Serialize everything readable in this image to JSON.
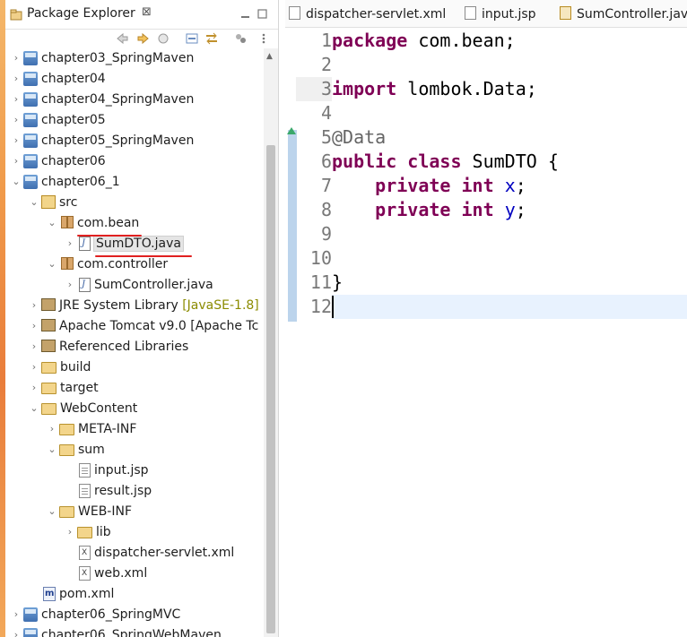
{
  "explorer": {
    "title": "Package Explorer",
    "close_glyph": "⊠",
    "tree": [
      {
        "label": "chapter03_SpringMaven",
        "chev": "›",
        "icon": "maven-project-icon",
        "depth": 0
      },
      {
        "label": "chapter04",
        "chev": "›",
        "icon": "spring-project-icon",
        "depth": 0
      },
      {
        "label": "chapter04_SpringMaven",
        "chev": "›",
        "icon": "maven-project-icon",
        "depth": 0
      },
      {
        "label": "chapter05",
        "chev": "›",
        "icon": "spring-project-icon",
        "depth": 0
      },
      {
        "label": "chapter05_SpringMaven",
        "chev": "›",
        "icon": "maven-project-icon",
        "depth": 0
      },
      {
        "label": "chapter06",
        "chev": "›",
        "icon": "spring-project-icon",
        "depth": 0
      },
      {
        "label": "chapter06_1",
        "chev": "⌄",
        "icon": "maven-project-icon",
        "depth": 0
      },
      {
        "label": "src",
        "chev": "⌄",
        "icon": "source-folder-icon",
        "depth": 1
      },
      {
        "label": "com.bean",
        "chev": "⌄",
        "icon": "package-icon",
        "depth": 2
      },
      {
        "label": "SumDTO.java",
        "chev": "›",
        "icon": "java-file-icon",
        "depth": 3,
        "selected": true
      },
      {
        "label": "com.controller",
        "chev": "⌄",
        "icon": "package-icon",
        "depth": 2
      },
      {
        "label": "SumController.java",
        "chev": "›",
        "icon": "java-file-icon",
        "depth": 3
      },
      {
        "label": "JRE System Library",
        "decoration": "[JavaSE-1.8]",
        "chev": "›",
        "icon": "library-icon",
        "depth": 1
      },
      {
        "label": "Apache Tomcat v9.0 [Apache Tc",
        "chev": "›",
        "icon": "library-icon",
        "depth": 1
      },
      {
        "label": "Referenced Libraries",
        "chev": "›",
        "icon": "library-icon",
        "depth": 1
      },
      {
        "label": "build",
        "chev": "›",
        "icon": "folder-icon",
        "depth": 1
      },
      {
        "label": "target",
        "chev": "›",
        "icon": "folder-icon",
        "depth": 1
      },
      {
        "label": "WebContent",
        "chev": "⌄",
        "icon": "web-folder-icon",
        "depth": 1
      },
      {
        "label": "META-INF",
        "chev": "›",
        "icon": "folder-icon",
        "depth": 2
      },
      {
        "label": "sum",
        "chev": "⌄",
        "icon": "folder-icon",
        "depth": 2
      },
      {
        "label": "input.jsp",
        "chev": "",
        "icon": "jsp-file-icon",
        "depth": 3
      },
      {
        "label": "result.jsp",
        "chev": "",
        "icon": "jsp-file-icon",
        "depth": 3
      },
      {
        "label": "WEB-INF",
        "chev": "⌄",
        "icon": "folder-icon",
        "depth": 2
      },
      {
        "label": "lib",
        "chev": "›",
        "icon": "folder-icon",
        "depth": 3
      },
      {
        "label": "dispatcher-servlet.xml",
        "chev": "",
        "icon": "xml-file-icon",
        "depth": 3
      },
      {
        "label": "web.xml",
        "chev": "",
        "icon": "xml-file-icon",
        "depth": 3
      },
      {
        "label": "pom.xml",
        "chev": "",
        "icon": "pom-file-icon",
        "depth": 1
      },
      {
        "label": "chapter06_SpringMVC",
        "chev": "›",
        "icon": "maven-project-icon",
        "depth": 0
      },
      {
        "label": "chapter06_SpringWebMaven",
        "chev": "›",
        "icon": "maven-project-icon",
        "depth": 0
      }
    ]
  },
  "editor": {
    "tabs": [
      {
        "label": "dispatcher-servlet.xml",
        "icon": "xml-file-icon"
      },
      {
        "label": "input.jsp",
        "icon": "jsp-file-icon"
      },
      {
        "label": "SumController.java",
        "icon": "java-file-icon"
      }
    ],
    "line_numbers": [
      "1",
      "2",
      "3",
      "4",
      "5",
      "6",
      "7",
      "8",
      "9",
      "10",
      "11",
      "12"
    ]
  },
  "colors": {
    "keyword": "#7f0055",
    "annotation": "#646464",
    "field": "#0000c0",
    "underline": "#e02020"
  }
}
